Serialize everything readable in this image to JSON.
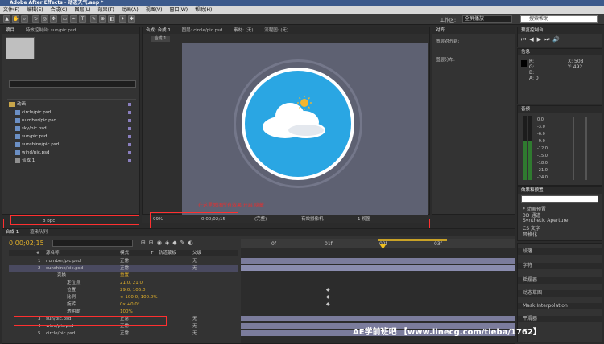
{
  "window": {
    "title": "Adobe After Effects - 动态天气.aep *"
  },
  "menu": [
    "文件(F)",
    "编辑(E)",
    "合成(C)",
    "图层(L)",
    "效果(T)",
    "动画(A)",
    "视图(V)",
    "窗口(W)",
    "帮助(H)"
  ],
  "toolbar": {
    "workspace_label": "工作区:",
    "workspace_value": "全屏播放",
    "help_placeholder": "搜索帮助"
  },
  "project_panel": {
    "tabs": [
      "项目",
      "特效控制台: sun/pic.psd"
    ],
    "root_folder": "动画",
    "files": [
      "circle/pic.psd",
      "number/pic.psd",
      "sky/pic.psd",
      "sun/pic.psd",
      "sunshine/pic.psd",
      "wind/pic.psd",
      "合成 1"
    ],
    "footer": "8 bpc"
  },
  "comp_panel": {
    "tabs": [
      "合成: 合成 1",
      "图层: circle/pic.psd",
      "素材: (无)",
      "流程图: (无)"
    ],
    "subtab": "合成 1",
    "zoom": "99%",
    "timecode": "0;00;02;15",
    "view": "(完整)",
    "camera": "有效摄像机",
    "views": "1 视图",
    "annotation": "在这里关闭所有效果 开启 隐藏"
  },
  "align_panel": {
    "tab": "对齐",
    "label1": "图层对齐到:",
    "label2": "图层分布:"
  },
  "info_panel": {
    "tab": "信息",
    "r": "R:",
    "g": "G:",
    "b": "B:",
    "a": "A: 0",
    "x": "X: 508",
    "y": "Y: 492"
  },
  "preview_panel": {
    "tab": "预览控制台"
  },
  "audio_panel": {
    "tab": "音频",
    "levels": [
      "0.0",
      "-3.0",
      "-6.0",
      "-9.0",
      "-12.0",
      "-15.0",
      "-18.0",
      "-21.0",
      "-24.0"
    ]
  },
  "effects_panel": {
    "tab": "效果和预置",
    "items": [
      "* 动画预置",
      "3D 通道",
      "Synthetic Aperture",
      "CS 文字",
      "风格化"
    ]
  },
  "right_bottom": [
    "段落",
    "字符",
    "摇摆器",
    "动态草图",
    "Mask Interpolation",
    "平滑器"
  ],
  "timeline": {
    "tabs": [
      "合成 1",
      "渲染队列"
    ],
    "timecode": "0;00;02;15",
    "headers": [
      "#",
      "源名称",
      "模式",
      "T",
      "轨道蒙板",
      "父级"
    ],
    "rows": [
      {
        "num": "1",
        "name": "number/pic.psd",
        "mode": "正常",
        "parent": "无"
      },
      {
        "num": "2",
        "name": "sunshine/pic.psd",
        "mode": "正常",
        "parent": "无"
      },
      {
        "num": "",
        "name": "变换",
        "mode": "重置",
        "parent": ""
      },
      {
        "num": "",
        "name": "定位点",
        "mode": "21.0, 21.0",
        "parent": ""
      },
      {
        "num": "",
        "name": "位置",
        "mode": "29.0, 106.0",
        "parent": ""
      },
      {
        "num": "",
        "name": "比例",
        "mode": "∞ 100.0, 100.0%",
        "parent": ""
      },
      {
        "num": "",
        "name": "旋转",
        "mode": "0x +0.0°",
        "parent": ""
      },
      {
        "num": "",
        "name": "透明度",
        "mode": "100%",
        "parent": ""
      },
      {
        "num": "3",
        "name": "sun/pic.psd",
        "mode": "正常",
        "parent": "无"
      },
      {
        "num": "4",
        "name": "wind/pic.psd",
        "mode": "正常",
        "parent": "无"
      },
      {
        "num": "5",
        "name": "circle/pic.psd",
        "mode": "正常",
        "parent": "无"
      }
    ],
    "ruler": [
      "0f",
      "01f",
      "02f",
      "03f"
    ]
  },
  "watermark": "AE学前班吧 【www.linecg.com/tieba/1762】"
}
